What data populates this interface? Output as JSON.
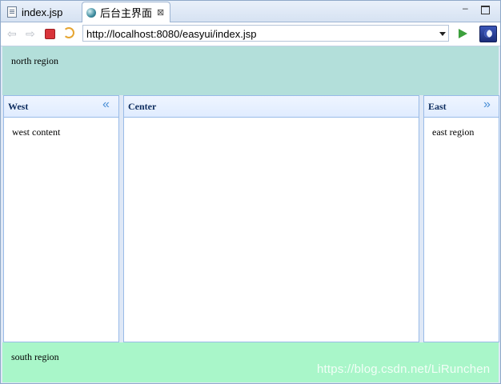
{
  "tabs": [
    {
      "label": "index.jsp",
      "icon": "file-icon"
    },
    {
      "label": "后台主界面",
      "icon": "globe-icon",
      "active": true
    }
  ],
  "window": {
    "close_tab": "⊠"
  },
  "toolbar": {
    "url": "http://localhost:8080/easyui/index.jsp"
  },
  "north": {
    "text": "north region"
  },
  "west": {
    "title": "West",
    "content": "west content",
    "collapse": "«"
  },
  "center": {
    "title": "Center"
  },
  "east": {
    "title": "East",
    "content": "east region",
    "collapse": "»"
  },
  "south": {
    "text": "south region"
  },
  "watermark": "https://blog.csdn.net/LiRunchen",
  "colors": {
    "north_bg": "#b3dfda",
    "south_bg": "#a9f6c9",
    "panel_border": "#99bbe8",
    "panel_title": "#0e2d5f"
  }
}
